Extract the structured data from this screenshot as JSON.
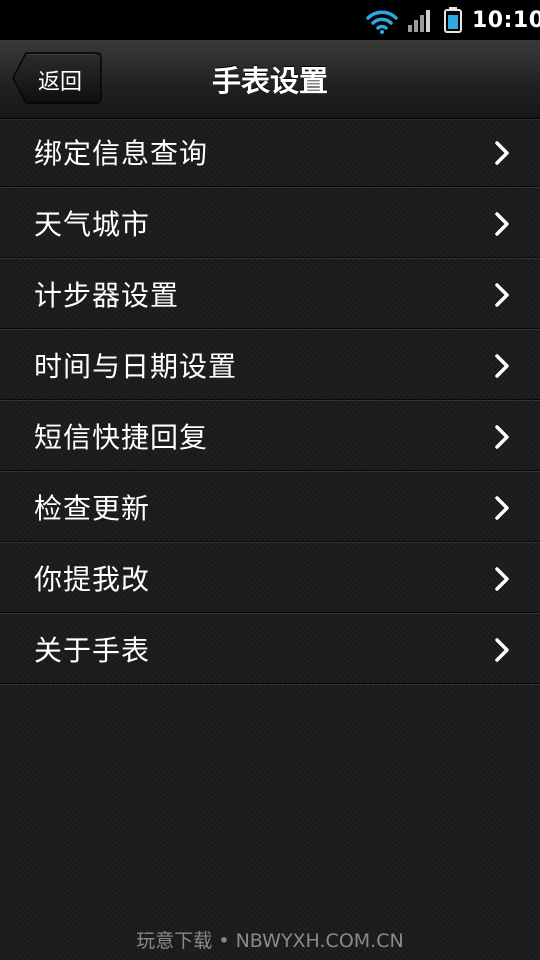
{
  "status_bar": {
    "time": "10:10",
    "icons": [
      "wifi-icon",
      "signal-icon",
      "battery-icon"
    ]
  },
  "header": {
    "back_label": "返回",
    "title": "手表设置"
  },
  "menu": {
    "items": [
      {
        "label": "绑定信息查询"
      },
      {
        "label": "天气城市"
      },
      {
        "label": "计步器设置"
      },
      {
        "label": "时间与日期设置"
      },
      {
        "label": "短信快捷回复"
      },
      {
        "label": "检查更新"
      },
      {
        "label": "你提我改"
      },
      {
        "label": "关于手表"
      }
    ]
  },
  "watermark": "玩意下载 • NBWYXH.COM.CN",
  "colors": {
    "background": "#1c1c1c",
    "wifi": "#2ea8e0",
    "battery": "#2ea8e0",
    "text": "#ffffff"
  }
}
